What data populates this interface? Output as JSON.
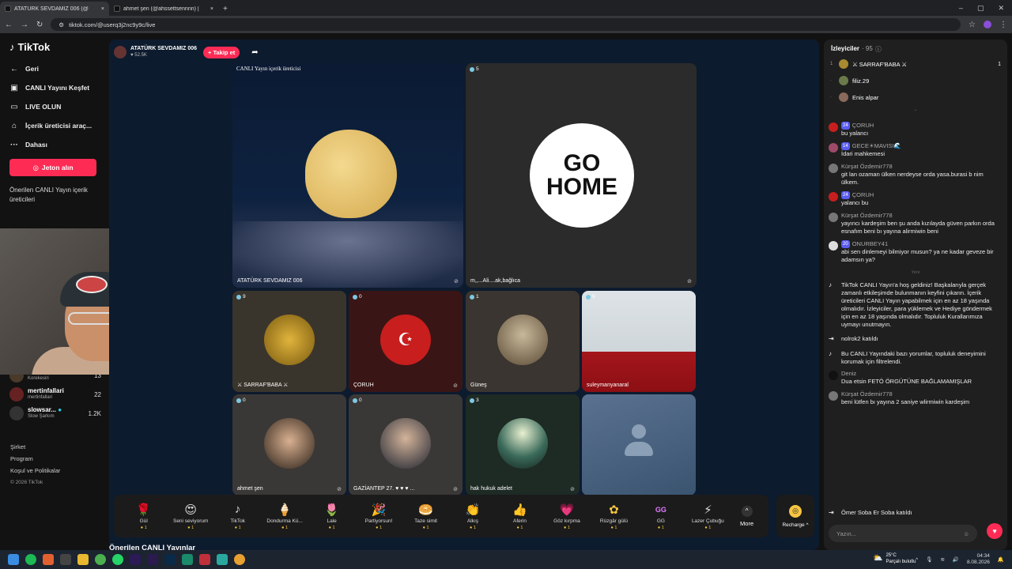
{
  "browser": {
    "tabs": [
      {
        "title": "ATATÜRK SEVDAMIZ 006 (@",
        "active": true
      },
      {
        "title": "ahmet şen (@ahssettsennnn) |",
        "active": false
      }
    ],
    "url": "tiktok.com/@userq3j2nc9y9c/live"
  },
  "sidebar": {
    "logo": "TikTok",
    "nav": [
      {
        "icon": "back-icon",
        "glyph": "←",
        "label": "Geri"
      },
      {
        "icon": "tv-icon",
        "glyph": "▣",
        "label": "CANLI Yayını Keşfet"
      },
      {
        "icon": "live-icon",
        "glyph": "▭",
        "label": "LIVE OLUN"
      },
      {
        "icon": "creator-tools-icon",
        "glyph": "⌂",
        "label": "İçerik üreticisi araç..."
      },
      {
        "icon": "more-icon",
        "glyph": "···",
        "label": "Dahası"
      }
    ],
    "coins_button": "Jeton alın",
    "suggested_heading": "Önerilen CANLI Yayın içerik üreticileri",
    "creators": [
      {
        "name": "korekesiri",
        "handle": "Korekesiri",
        "count": "13"
      },
      {
        "name": "mertinfallari",
        "handle": "mertinfallari",
        "count": "22"
      },
      {
        "name": "slowsar...",
        "handle": "Slow Şarkım",
        "count": "1.2K"
      }
    ],
    "footer": [
      "Şirket",
      "Program",
      "Koşul ve Politikalar"
    ],
    "copyright": "© 2026 TikTok"
  },
  "stream": {
    "host_name": "ATATÜRK SEVDAMIZ 006",
    "host_likes": "52.5K",
    "follow_label": "+ Takip et",
    "main_tiles": [
      {
        "label": "CANLI Yayın içerik üreticisi",
        "name": "ATATÜRK SEVDAMIZ 006"
      },
      {
        "count": "5",
        "name": "m,,...Ali....ak,bağlıca"
      }
    ],
    "row1": [
      {
        "count": "9",
        "name": "⚔ SARRAF'BABA ⚔"
      },
      {
        "count": "0",
        "name": "ÇORUH"
      },
      {
        "count": "1",
        "name": "Güneş"
      },
      {
        "count": "9",
        "name": "suleymanyanaral"
      }
    ],
    "row2": [
      {
        "count": "0",
        "name": "ahmet şen"
      },
      {
        "count": "0",
        "name": "GAZİANTEP 27. ♥ ♥ ♥ ..."
      },
      {
        "count": "3",
        "name": "hak hukuk adelet"
      },
      {
        "count": "",
        "name": ""
      }
    ],
    "gifts": [
      {
        "icon": "rose-icon",
        "glyph": "🌹",
        "name": "Gül",
        "price": "1"
      },
      {
        "icon": "heart-face-icon",
        "glyph": "😍",
        "name": "Seni seviyorum",
        "price": "1"
      },
      {
        "icon": "tiktok-gift-icon",
        "glyph": "♪",
        "name": "TikTok",
        "price": "1"
      },
      {
        "icon": "icecream-icon",
        "glyph": "🍦",
        "name": "Dondurma Kü...",
        "price": "1"
      },
      {
        "icon": "tulip-icon",
        "glyph": "🌷",
        "name": "Lale",
        "price": "1"
      },
      {
        "icon": "party-icon",
        "glyph": "🎉",
        "name": "Partiyorsun!",
        "price": "1"
      },
      {
        "icon": "bread-icon",
        "glyph": "🥯",
        "name": "Taze simit",
        "price": "1"
      },
      {
        "icon": "clap-icon",
        "glyph": "👏",
        "name": "Alkış",
        "price": "1"
      },
      {
        "icon": "thumbs-icon",
        "glyph": "👍",
        "name": "Aferin",
        "price": "1"
      },
      {
        "icon": "wink-heart-icon",
        "glyph": "💗",
        "name": "Göz kırpma",
        "price": "1"
      },
      {
        "icon": "pinwheel-icon",
        "glyph": "✿",
        "name": "Rüzgâr gülü",
        "price": "1"
      },
      {
        "icon": "gg-icon",
        "glyph": "GG",
        "name": "GG",
        "price": "1"
      },
      {
        "icon": "lightstick-icon",
        "glyph": "⚡",
        "name": "Lazer Çubuğu",
        "price": "1"
      }
    ],
    "more_label": "More",
    "recharge_label": "Recharge ^"
  },
  "suggested_title": "Önerilen CANLI Yayınlar",
  "chat": {
    "viewers_label": "İzleyiciler",
    "viewers_count": "· 95",
    "top_viewers": [
      {
        "rank": "1",
        "name": "⚔ SARRAF'BABA ⚔",
        "right": "1"
      },
      {
        "rank": "·",
        "name": "filiz.29",
        "right": ""
      },
      {
        "rank": "·",
        "name": "Enis alpar",
        "right": ""
      }
    ],
    "messages": [
      {
        "badge": "24",
        "user": "ÇORUH",
        "text": "bu yalancı"
      },
      {
        "badge": "14",
        "user": "GECE☀MAVISI🌊",
        "text": "İdari mahkemesi"
      },
      {
        "badge": "",
        "user": "Kürşat Özdemir778",
        "text": "git lan ozaman ülken nerdeyse orda yasa.burasi b nim ülkem."
      },
      {
        "badge": "24",
        "user": "ÇORUH",
        "text": "yalancı bu"
      },
      {
        "badge": "",
        "user": "Kürşat Özdemir778",
        "text": "yayıncı kardeşim ben şu anda kızılayda güven parkın orda esnafım beni bı yayına alirmiwin beni"
      },
      {
        "badge": "20",
        "user": "ONURBEY41",
        "text": "abi sen dinlemeyi bilmiyor musun? ya ne kadar geveze bir adamsın ya?"
      }
    ],
    "new_label": "Yeni",
    "system_messages": [
      {
        "text": "TikTok CANLI Yayın'a hoş geldiniz! Başkalarıyla gerçek zamanlı etkileşimde bulunmanın keyfini çıkarın. İçerik üreticileri CANLI Yayın yapabilmek için en az 18 yaşında olmalıdır. İzleyiciler, para yüklemek ve Hediye göndermek için en az 18 yaşında olmalıdır. Topluluk Kurallarımıza uymayı unutmayın."
      },
      {
        "text": "nolrok2  katıldı"
      },
      {
        "text": "Bu CANLI Yayındaki bazı yorumlar, topluluk deneyimini korumak için filtrelendi."
      }
    ],
    "late_messages": [
      {
        "user": "Deniz",
        "text": "Dua etsin FETÖ ÖRGÜTÜNE BAĞLAMAMIŞLAR"
      },
      {
        "user": "Kürşat Özdemir778",
        "text": "beni lütfen bı yayına 2 saniye wlirmiwin kardeşim"
      }
    ],
    "join_notice": "Ömer Soba Er Soba  katıldı",
    "input_placeholder": "Yazın..."
  },
  "taskbar": {
    "weather_temp": "25°C",
    "weather_desc": "Parçalı bulutlu",
    "time": "04:34",
    "date": "8.08.2026"
  }
}
